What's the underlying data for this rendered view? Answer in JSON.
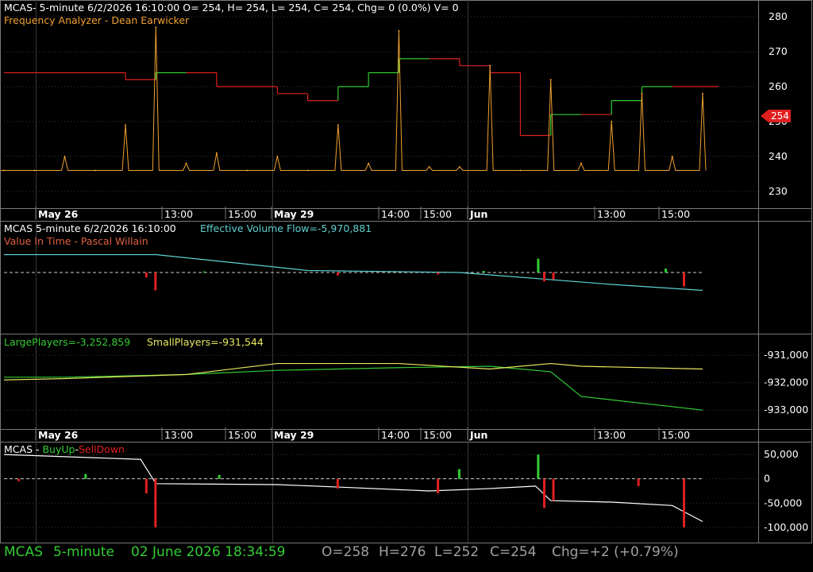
{
  "colors": {
    "background": "#000000",
    "frame": "#7a7a7a",
    "grid": "#3a3a3a",
    "white": "#ffffff",
    "orange": "#f0a030",
    "green": "#33cc33",
    "red": "#e02020",
    "cyan": "#5fd0d0",
    "yellow": "#e8e860",
    "status_green": "#33cc33",
    "status_gray": "#a0a0a0"
  },
  "panel1": {
    "header_line1": "MCAS- 5-minute 6/2/2026 16:10:00 O= 254, H= 254, L= 254, C= 254, Chg= 0 (0.0%) V= 0",
    "header_line2": "Frequency Analyzer - Dean Earwicker",
    "price_marker": "254"
  },
  "date_axis_top": [
    "May 26",
    "13:00",
    "15:00",
    "May 29",
    "14:00",
    "15:00",
    "Jun",
    "13:00",
    "15:00"
  ],
  "panel2": {
    "header_name": "MCAS 5-minute  6/2/2026 16:10:00",
    "header_value": "Effective Volume Flow=-5,970,881",
    "header_line2": "Value In Time - Pascal Willain"
  },
  "panel3": {
    "large_players": "LargePlayers=-3,252,859",
    "small_players": "SmallPlayers=-931,544"
  },
  "date_axis_bottom": [
    "May 26",
    "13:00",
    "15:00",
    "May 29",
    "14:00",
    "15:00",
    "Jun",
    "13:00",
    "15:00"
  ],
  "panel4": {
    "header_prefix": "MCAS - ",
    "header_buy": "BuyUp",
    "header_dash": "-",
    "header_sell": "SellDown"
  },
  "status": {
    "symbol": "MCAS",
    "interval": "5-minute",
    "date": "02 June 2026 18:34:59",
    "open": "O=258",
    "high": "H=276",
    "low": "L=252",
    "close": "C=254",
    "change": "Chg=+2 (+0.79%)"
  },
  "chart_data": [
    {
      "type": "line",
      "panel": "price",
      "y_ticks": [
        230,
        240,
        250,
        260,
        270,
        280
      ],
      "ylim": [
        227,
        283
      ],
      "x_ticks": [
        "May 26",
        "13:00",
        "15:00",
        "May 29",
        "14:00",
        "15:00",
        "Jun",
        "13:00",
        "15:00"
      ],
      "series": [
        {
          "style": "step",
          "x": [
            0,
            10,
            20,
            30,
            40,
            50,
            60,
            70,
            80,
            90,
            100,
            110,
            120,
            130,
            140,
            150,
            160,
            170,
            180,
            190,
            200,
            210,
            220,
            230
          ],
          "y": [
            264,
            264,
            264,
            264,
            262,
            264,
            264,
            260,
            260,
            258,
            256,
            260,
            264,
            268,
            268,
            266,
            264,
            246,
            252,
            252,
            256,
            260,
            260,
            260
          ]
        },
        {
          "style": "spikes",
          "x": [
            0,
            10,
            20,
            30,
            40,
            50,
            60,
            70,
            80,
            90,
            100,
            110,
            120,
            130,
            140,
            150,
            160,
            170,
            180,
            190,
            200,
            210,
            220,
            230
          ],
          "y": [
            236,
            236,
            240,
            236,
            249,
            277,
            238,
            241,
            236,
            240,
            236,
            249,
            238,
            276,
            237,
            237,
            266,
            236,
            262,
            238,
            250,
            258,
            240,
            258
          ]
        }
      ]
    },
    {
      "type": "bar",
      "panel": "effective-volume-flow",
      "series": [
        {
          "x": [
            0,
            50,
            100,
            150,
            200,
            230
          ],
          "y": [
            0.9,
            0.9,
            0.1,
            0.0,
            -0.6,
            -0.9
          ]
        }
      ],
      "bars": [
        {
          "x": 47,
          "y": -0.25
        },
        {
          "x": 50,
          "y": -0.9
        },
        {
          "x": 66,
          "y": 0.05
        },
        {
          "x": 110,
          "y": -0.15
        },
        {
          "x": 143,
          "y": -0.1
        },
        {
          "x": 158,
          "y": 0.08
        },
        {
          "x": 176,
          "y": 0.7
        },
        {
          "x": 178,
          "y": -0.45
        },
        {
          "x": 181,
          "y": -0.35
        },
        {
          "x": 218,
          "y": 0.2
        },
        {
          "x": 224,
          "y": -0.7
        }
      ]
    },
    {
      "type": "line",
      "panel": "players",
      "y_ticks": [
        -931000,
        -932000,
        -933000
      ],
      "ylim": [
        -933400,
        -930500
      ],
      "series": [
        {
          "name": "LargePlayers",
          "x": [
            0,
            20,
            60,
            90,
            130,
            160,
            180,
            190,
            230
          ],
          "y": [
            -931800,
            -931800,
            -931700,
            -931550,
            -931450,
            -931400,
            -931600,
            -932500,
            -933000
          ]
        },
        {
          "name": "SmallPlayers",
          "x": [
            0,
            20,
            60,
            90,
            130,
            160,
            180,
            190,
            230
          ],
          "y": [
            -931900,
            -931850,
            -931700,
            -931300,
            -931300,
            -931500,
            -931300,
            -931400,
            -931500
          ]
        }
      ]
    },
    {
      "type": "bar",
      "panel": "buyup-selldown",
      "y_ticks": [
        50000,
        0,
        -50000,
        -100000
      ],
      "ylim": [
        -115000,
        60000
      ],
      "series": [
        {
          "x": [
            0,
            45,
            50,
            90,
            110,
            140,
            160,
            175,
            180,
            200,
            220,
            230
          ],
          "y": [
            50000,
            40000,
            -10000,
            -12000,
            -17000,
            -25000,
            -20000,
            -15000,
            -45000,
            -48000,
            -55000,
            -88000
          ]
        }
      ],
      "bars": [
        {
          "x": 5,
          "y": -5000
        },
        {
          "x": 47,
          "y": -30000
        },
        {
          "x": 50,
          "y": -100000
        },
        {
          "x": 27,
          "y": 10000
        },
        {
          "x": 71,
          "y": 8000
        },
        {
          "x": 110,
          "y": -20000
        },
        {
          "x": 143,
          "y": -30000
        },
        {
          "x": 150,
          "y": 20000
        },
        {
          "x": 176,
          "y": 50000
        },
        {
          "x": 178,
          "y": -60000
        },
        {
          "x": 181,
          "y": -45000
        },
        {
          "x": 209,
          "y": -15000
        },
        {
          "x": 224,
          "y": -100000
        }
      ]
    }
  ]
}
